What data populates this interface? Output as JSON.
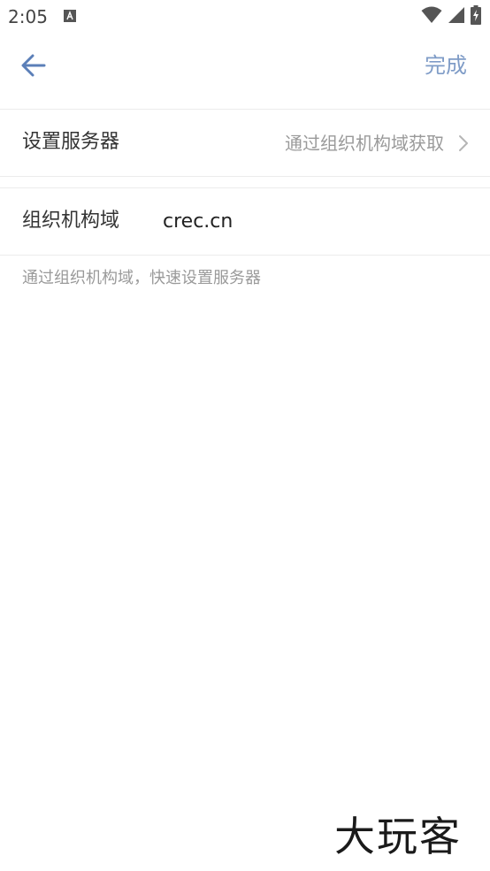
{
  "status_bar": {
    "time": "2:05",
    "icons": [
      "notification-a-icon",
      "wifi-icon",
      "signal-icon",
      "battery-charging-icon"
    ]
  },
  "app_bar": {
    "back_icon": "arrow-left-icon",
    "done_label": "完成",
    "accent_color": "#7f9cc7"
  },
  "server_row": {
    "label": "设置服务器",
    "value": "通过组织机构域获取",
    "chevron_icon": "chevron-right-icon"
  },
  "domain_row": {
    "label": "组织机构域",
    "value": "crec.cn"
  },
  "hint": "通过组织机构域，快速设置服务器",
  "watermark": "大玩客"
}
